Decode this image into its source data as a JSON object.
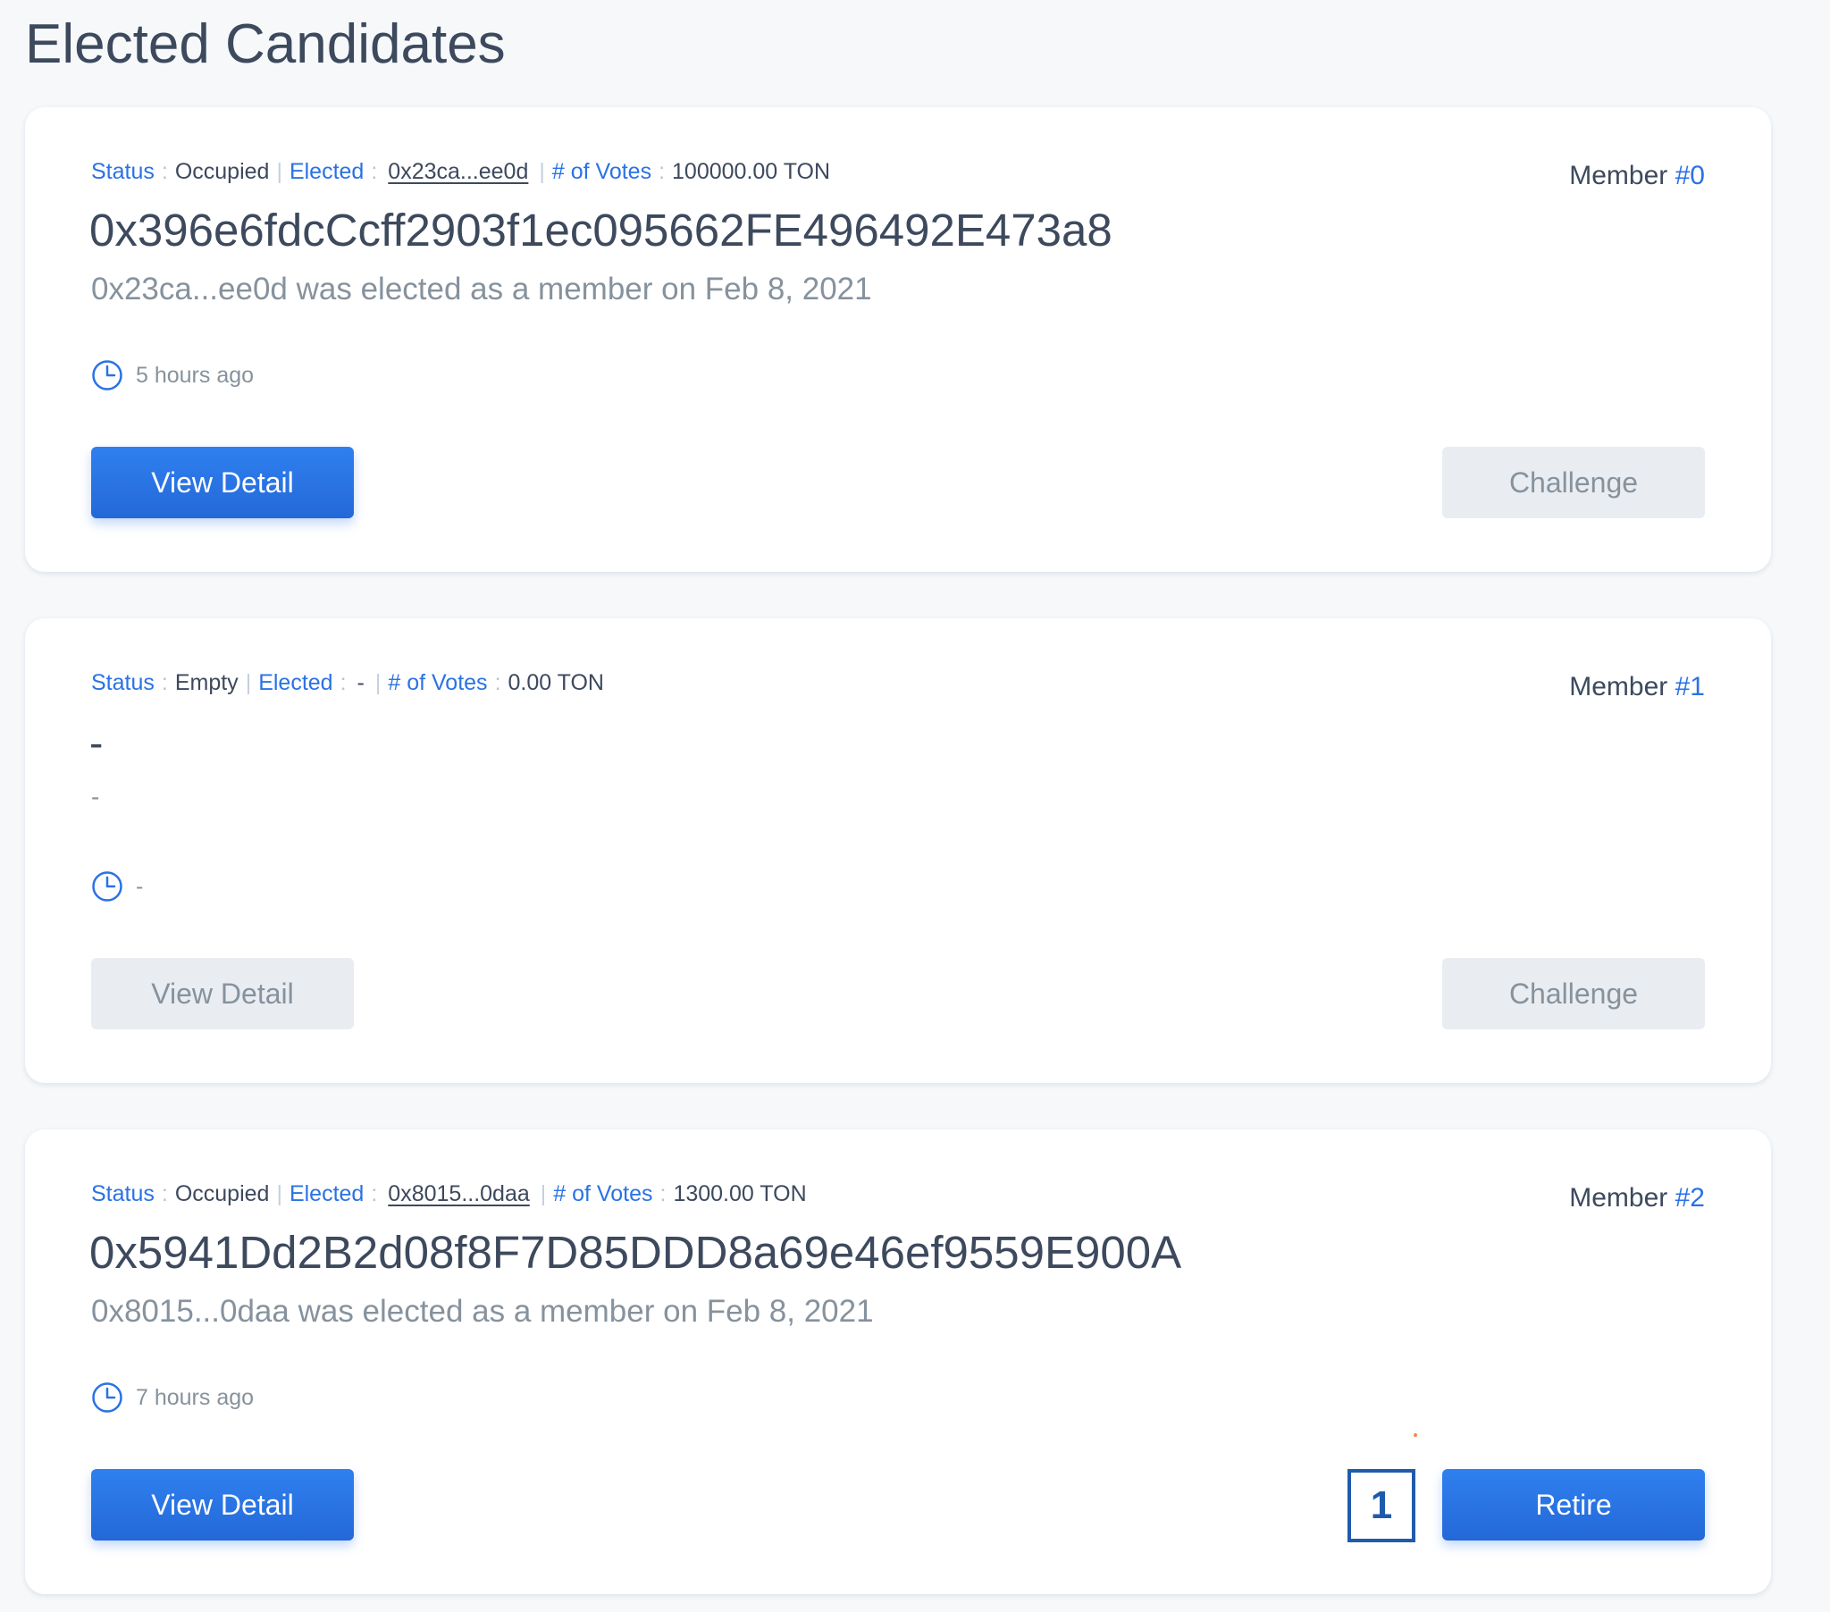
{
  "page": {
    "title": "Elected Candidates"
  },
  "labels": {
    "status": "Status",
    "elected": "Elected",
    "votes": "# of Votes",
    "colon": ":",
    "bar": "|",
    "member": "Member"
  },
  "colors": {
    "accent": "#2a72e5",
    "text": "#3d495d",
    "muted": "#86929d",
    "disabled_bg": "#e9edf1",
    "badge_border": "#1f5bab"
  },
  "icons": {
    "time": "clock-icon"
  },
  "cards": [
    {
      "status": "Occupied",
      "elected": "0x23ca...ee0d",
      "votes": "100000.00 TON",
      "member_number": "#0",
      "address": "0x396e6fdcCcff2903f1ec095662FE496492E473a8",
      "subtext": "0x23ca...ee0d was elected as a member on Feb 8, 2021",
      "time": "5 hours ago",
      "left_button": "View Detail",
      "left_button_enabled": true,
      "right_button": "Challenge",
      "right_button_enabled": false
    },
    {
      "status": "Empty",
      "elected": "-",
      "votes": "0.00 TON",
      "member_number": "#1",
      "address": "-",
      "subtext": "-",
      "time": "-",
      "left_button": "View Detail",
      "left_button_enabled": false,
      "right_button": "Challenge",
      "right_button_enabled": false
    },
    {
      "status": "Occupied",
      "elected": "0x8015...0daa",
      "votes": "1300.00 TON",
      "member_number": "#2",
      "address": "0x5941Dd2B2d08f8F7D85DDD8a69e46ef9559E900A",
      "subtext": "0x8015...0daa was elected as a member on Feb 8, 2021",
      "time": "7 hours ago",
      "left_button": "View Detail",
      "left_button_enabled": true,
      "right_button": "Retire",
      "right_button_enabled": true,
      "annotation_badge": "1"
    }
  ]
}
